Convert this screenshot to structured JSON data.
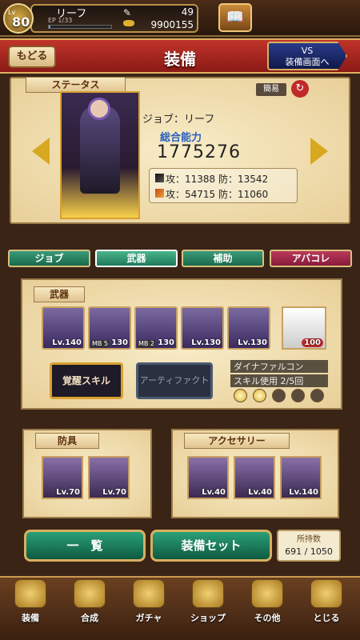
{
  "player": {
    "level_prefix": "Lv",
    "level": "80",
    "name": "リーフ",
    "ep": "EP 1/33",
    "ep_fill": 0.03,
    "count1": "49",
    "count2": "9900155"
  },
  "header": {
    "back": "もどる",
    "title": "装備",
    "vs_line1": "VS",
    "vs_line2": "装備画面へ"
  },
  "status": {
    "tab": "ステータス",
    "simple": "簡易",
    "job": "ジョブ：リーフ",
    "power_label": "総合能力",
    "power": "1775276",
    "stat1": "攻：11388 防：13542",
    "stat2": "攻：54715 防：11060"
  },
  "tabs": [
    "ジョブ",
    "武器",
    "補助",
    "アバコレ"
  ],
  "weapons": {
    "tab": "武器",
    "slots": [
      {
        "lv": "Lv.140",
        "mb": ""
      },
      {
        "lv": "130",
        "mb": "MB 5"
      },
      {
        "lv": "130",
        "mb": "MB 2"
      },
      {
        "lv": "Lv.130",
        "mb": ""
      },
      {
        "lv": "Lv.130",
        "mb": ""
      }
    ],
    "extra_lv": "100",
    "awake": "覚醒スキル",
    "artifact": "アーティファクト",
    "skill_name": "ダイナファルコン",
    "skill_use": "スキル使用 2/5回",
    "dots_on": 2,
    "dots_total": 5
  },
  "armor": {
    "tab": "防具",
    "slots": [
      "Lv.70",
      "Lv.70"
    ]
  },
  "accessory": {
    "tab": "アクセサリー",
    "slots": [
      "Lv.40",
      "Lv.40",
      "Lv.140"
    ]
  },
  "buttons": {
    "list": "一　覧",
    "set": "装備セット",
    "hold_label": "所持数",
    "hold_val": "691 / 1050"
  },
  "nav": [
    "装備",
    "合成",
    "ガチャ",
    "ショップ",
    "その他",
    "とじる"
  ]
}
